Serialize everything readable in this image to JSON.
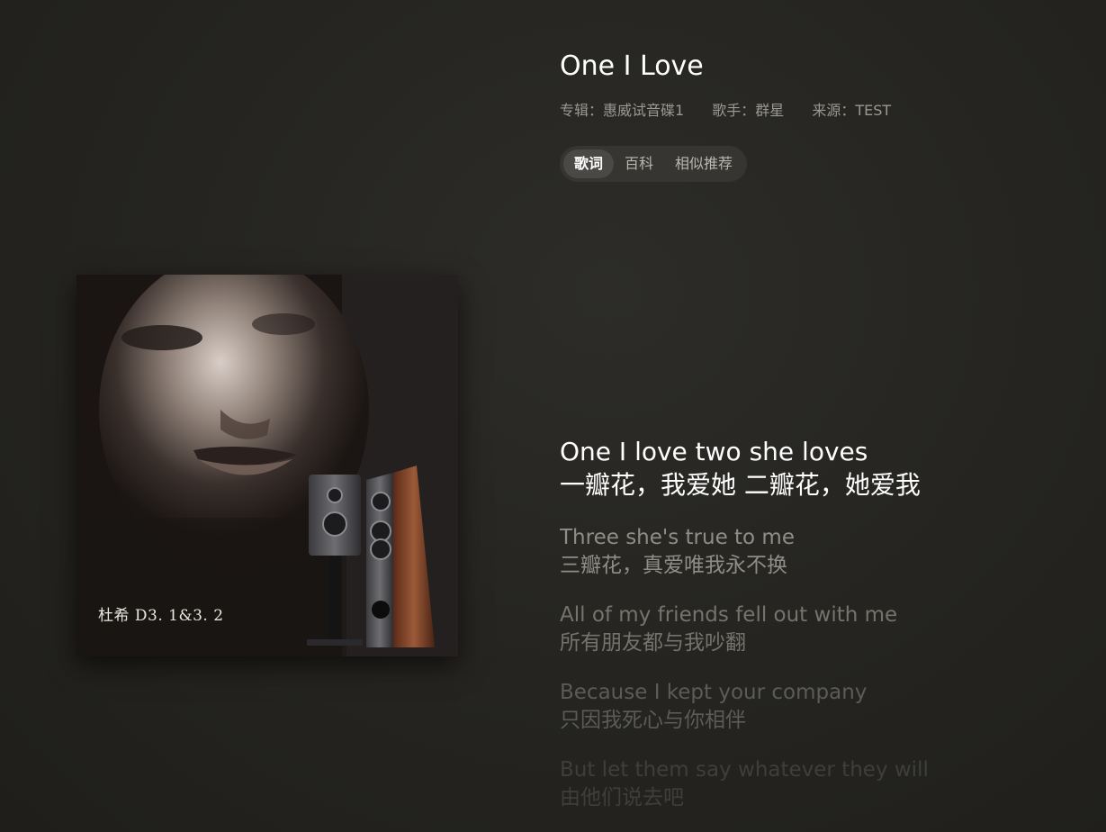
{
  "song": {
    "title": "One I Love",
    "album_label": "专辑：惠威试音碟1",
    "artist_label": "歌手：群星",
    "source_label": "来源：TEST"
  },
  "tabs": [
    {
      "label": "歌词",
      "active": true
    },
    {
      "label": "百科",
      "active": false
    },
    {
      "label": "相似推荐",
      "active": false
    }
  ],
  "cover": {
    "caption": "杜希 D3. 1&3. 2"
  },
  "lyrics": [
    {
      "en": "One I love two she loves",
      "zh": "一瓣花，我爱她 二瓣花，她爱我",
      "current": true
    },
    {
      "en": "Three she's true to me",
      "zh": "三瓣花，真爱唯我永不换",
      "current": false
    },
    {
      "en": "All of my friends fell out with me",
      "zh": "所有朋友都与我吵翻",
      "current": false
    },
    {
      "en": "Because I kept your company",
      "zh": "只因我死心与你相伴",
      "current": false
    },
    {
      "en": "But let them say whatever they will",
      "zh": "由他们说去吧",
      "current": false
    }
  ]
}
